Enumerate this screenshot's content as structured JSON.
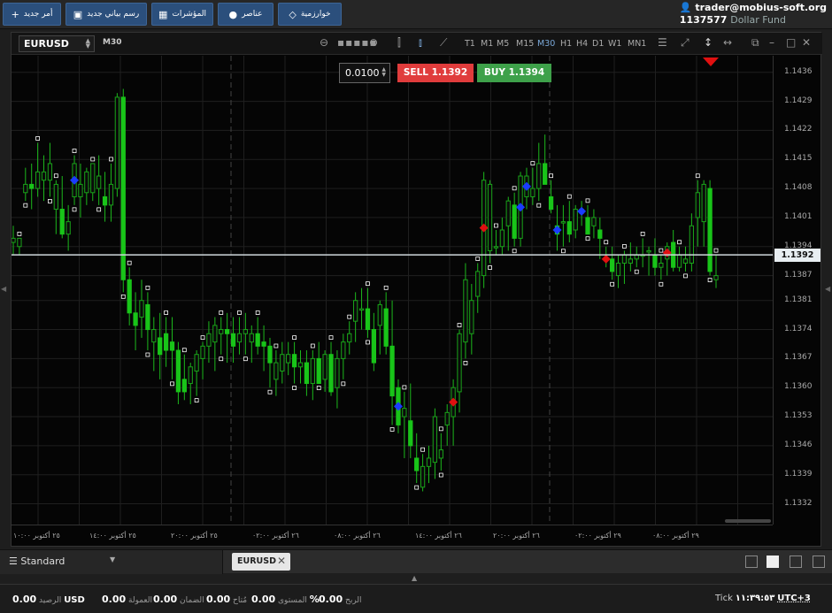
{
  "toolbar": {
    "new_order": "أمر جديد",
    "new_chart": "رسم بياني جديد",
    "indicators": "المؤشرات",
    "elements": "عناصر",
    "algorithms": "خوارزمية"
  },
  "account": {
    "email": "trader@mobius-soft.org",
    "id": "1137577",
    "fund": "Dollar Fund"
  },
  "chart": {
    "symbol": "EURUSD",
    "timeframe_badge": "M30",
    "timeframes": [
      "T1",
      "M1",
      "M5",
      "M15",
      "M30",
      "H1",
      "H4",
      "D1",
      "W1",
      "MN1"
    ],
    "active_timeframe": "M30",
    "lot": "0.0100",
    "sell_label": "SELL",
    "sell_price": "1.1392",
    "buy_label": "BUY",
    "buy_price": "1.1394",
    "current_price": "1.1392"
  },
  "chart_data": {
    "type": "candlestick",
    "price_ticks": [
      "1.1436",
      "1.1429",
      "1.1422",
      "1.1415",
      "1.1408",
      "1.1401",
      "1.1394",
      "1.1387",
      "1.1381",
      "1.1374",
      "1.1367",
      "1.1360",
      "1.1353",
      "1.1346",
      "1.1339",
      "1.1332"
    ],
    "ylim": [
      1.1327,
      1.144
    ],
    "time_ticks": [
      "٢٥ أكتوبر ١٠:٠٠",
      "٢٥ أكتوبر ١٤:٠٠",
      "٢٥ أكتوبر ٢٠:٠٠",
      "٢٦ أكتوبر ٠٢:٠٠",
      "٢٦ أكتوبر ٠٨:٠٠",
      "٢٦ أكتوبر ١٤:٠٠",
      "٢٦ أكتوبر ٢٠:٠٠",
      "٢٩ أكتوبر ٠٢:٠٠",
      "٢٩ أكتوبر ٠٨:٠٠"
    ],
    "candles": [
      [
        1.1395,
        1.1399,
        1.1392,
        1.1396
      ],
      [
        1.1394,
        1.1396,
        1.1392,
        1.1396
      ],
      [
        1.1407,
        1.1413,
        1.1405,
        1.1409
      ],
      [
        1.1409,
        1.1414,
        1.1403,
        1.1408
      ],
      [
        1.1408,
        1.1419,
        1.1406,
        1.1412
      ],
      [
        1.141,
        1.1416,
        1.1405,
        1.1412
      ],
      [
        1.141,
        1.1419,
        1.1406,
        1.1414
      ],
      [
        1.1403,
        1.141,
        1.1397,
        1.1409
      ],
      [
        1.1403,
        1.1411,
        1.1396,
        1.1397
      ],
      [
        1.1397,
        1.1404,
        1.1393,
        1.14
      ],
      [
        1.1406,
        1.1416,
        1.1404,
        1.1414
      ],
      [
        1.1406,
        1.1414,
        1.1401,
        1.1409
      ],
      [
        1.1407,
        1.1413,
        1.1404,
        1.1412
      ],
      [
        1.1407,
        1.1414,
        1.1405,
        1.1414
      ],
      [
        1.1408,
        1.1416,
        1.1404,
        1.1411
      ],
      [
        1.1406,
        1.1412,
        1.14,
        1.1404
      ],
      [
        1.1404,
        1.1414,
        1.14,
        1.1409
      ],
      [
        1.1408,
        1.1431,
        1.1406,
        1.143
      ],
      [
        1.143,
        1.1432,
        1.1383,
        1.1386
      ],
      [
        1.1386,
        1.1389,
        1.1375,
        1.1378
      ],
      [
        1.1378,
        1.1383,
        1.1369,
        1.1375
      ],
      [
        1.1377,
        1.1386,
        1.1372,
        1.1381
      ],
      [
        1.138,
        1.1383,
        1.1369,
        1.1374
      ],
      [
        1.1371,
        1.1377,
        1.1364,
        1.1374
      ],
      [
        1.1372,
        1.1378,
        1.1362,
        1.1368
      ],
      [
        1.1373,
        1.1377,
        1.1365,
        1.1369
      ],
      [
        1.1371,
        1.1377,
        1.1362,
        1.1369
      ],
      [
        1.1369,
        1.1371,
        1.1356,
        1.1359
      ],
      [
        1.1362,
        1.1368,
        1.1357,
        1.1359
      ],
      [
        1.1361,
        1.1366,
        1.1356,
        1.1365
      ],
      [
        1.1364,
        1.1369,
        1.1358,
        1.1368
      ],
      [
        1.1367,
        1.1371,
        1.1362,
        1.137
      ],
      [
        1.137,
        1.1376,
        1.1366,
        1.1373
      ],
      [
        1.1371,
        1.1377,
        1.1364,
        1.1375
      ],
      [
        1.1373,
        1.1377,
        1.1368,
        1.1374
      ],
      [
        1.1374,
        1.1378,
        1.1366,
        1.1373
      ],
      [
        1.1373,
        1.1377,
        1.1366,
        1.137
      ],
      [
        1.1371,
        1.1377,
        1.1368,
        1.1373
      ],
      [
        1.1373,
        1.1378,
        1.1368,
        1.1374
      ],
      [
        1.1371,
        1.1375,
        1.1366,
        1.1373
      ],
      [
        1.1373,
        1.1377,
        1.1368,
        1.137
      ],
      [
        1.1371,
        1.1375,
        1.1364,
        1.137
      ],
      [
        1.137,
        1.1372,
        1.136,
        1.1366
      ],
      [
        1.1362,
        1.1369,
        1.1358,
        1.1366
      ],
      [
        1.1364,
        1.1371,
        1.1361,
        1.1368
      ],
      [
        1.1366,
        1.1371,
        1.1363,
        1.1368
      ],
      [
        1.1368,
        1.1371,
        1.1361,
        1.1365
      ],
      [
        1.1365,
        1.1369,
        1.1361,
        1.1366
      ],
      [
        1.1366,
        1.1369,
        1.1358,
        1.1361
      ],
      [
        1.1361,
        1.1369,
        1.1357,
        1.1367
      ],
      [
        1.1367,
        1.1371,
        1.1361,
        1.1361
      ],
      [
        1.1362,
        1.1369,
        1.1359,
        1.1368
      ],
      [
        1.1368,
        1.1371,
        1.1358,
        1.1359
      ],
      [
        1.136,
        1.1369,
        1.1355,
        1.1367
      ],
      [
        1.1367,
        1.1373,
        1.1362,
        1.1371
      ],
      [
        1.1371,
        1.1376,
        1.1368,
        1.1373
      ],
      [
        1.1376,
        1.1383,
        1.1371,
        1.1381
      ],
      [
        1.1379,
        1.1384,
        1.1374,
        1.1379
      ],
      [
        1.1379,
        1.1384,
        1.1372,
        1.1374
      ],
      [
        1.1374,
        1.1378,
        1.1364,
        1.1366
      ],
      [
        1.1375,
        1.1381,
        1.1368,
        1.138
      ],
      [
        1.1379,
        1.1383,
        1.1368,
        1.137
      ],
      [
        1.137,
        1.1381,
        1.1351,
        1.1358
      ],
      [
        1.136,
        1.1362,
        1.1349,
        1.1351
      ],
      [
        1.1353,
        1.1359,
        1.1343,
        1.1355
      ],
      [
        1.1352,
        1.1361,
        1.1343,
        1.1346
      ],
      [
        1.1343,
        1.1349,
        1.1337,
        1.134
      ],
      [
        1.1336,
        1.1344,
        1.1335,
        1.1341
      ],
      [
        1.1341,
        1.1346,
        1.1337,
        1.1343
      ],
      [
        1.1342,
        1.1355,
        1.1338,
        1.1353
      ],
      [
        1.1343,
        1.1349,
        1.134,
        1.1345
      ],
      [
        1.1351,
        1.1356,
        1.1346,
        1.1354
      ],
      [
        1.1353,
        1.1362,
        1.1346,
        1.136
      ],
      [
        1.1359,
        1.1374,
        1.1354,
        1.1373
      ],
      [
        1.1371,
        1.139,
        1.1367,
        1.1386
      ],
      [
        1.1373,
        1.1385,
        1.1368,
        1.1381
      ],
      [
        1.1382,
        1.139,
        1.1378,
        1.1388
      ],
      [
        1.1387,
        1.1412,
        1.1384,
        1.141
      ],
      [
        1.1393,
        1.141,
        1.139,
        1.1409
      ],
      [
        1.1394,
        1.1398,
        1.1392,
        1.1394
      ],
      [
        1.1394,
        1.1401,
        1.1392,
        1.1398
      ],
      [
        1.1399,
        1.1406,
        1.1393,
        1.1405
      ],
      [
        1.1404,
        1.1407,
        1.1394,
        1.1396
      ],
      [
        1.1396,
        1.1412,
        1.1394,
        1.1411
      ],
      [
        1.1406,
        1.1413,
        1.1403,
        1.1411
      ],
      [
        1.1406,
        1.1413,
        1.1404,
        1.1408
      ],
      [
        1.1408,
        1.1419,
        1.1405,
        1.1414
      ],
      [
        1.1414,
        1.1421,
        1.1409,
        1.1409
      ],
      [
        1.1406,
        1.141,
        1.1402,
        1.1403
      ],
      [
        1.1399,
        1.1404,
        1.1393,
        1.1397
      ],
      [
        1.14,
        1.1404,
        1.1394,
        1.14
      ],
      [
        1.14,
        1.1405,
        1.1395,
        1.1397
      ],
      [
        1.1398,
        1.1404,
        1.1396,
        1.1403
      ],
      [
        1.1402,
        1.1405,
        1.1399,
        1.1403
      ],
      [
        1.1401,
        1.1404,
        1.1397,
        1.1397
      ],
      [
        1.1399,
        1.1403,
        1.1396,
        1.1401
      ],
      [
        1.1398,
        1.1401,
        1.1391,
        1.1396
      ],
      [
        1.1391,
        1.1394,
        1.1389,
        1.1391
      ],
      [
        1.1391,
        1.1394,
        1.1386,
        1.1388
      ],
      [
        1.1387,
        1.1392,
        1.1384,
        1.139
      ],
      [
        1.139,
        1.1393,
        1.1385,
        1.1392
      ],
      [
        1.139,
        1.1395,
        1.1388,
        1.1391
      ],
      [
        1.1391,
        1.1394,
        1.1389,
        1.1392
      ],
      [
        1.1392,
        1.1396,
        1.1389,
        1.1392
      ],
      [
        1.1393,
        1.1394,
        1.1387,
        1.1393
      ],
      [
        1.1392,
        1.1396,
        1.1387,
        1.1389
      ],
      [
        1.1389,
        1.1392,
        1.1386,
        1.139
      ],
      [
        1.1391,
        1.1395,
        1.1387,
        1.1394
      ],
      [
        1.1395,
        1.1398,
        1.1388,
        1.1389
      ],
      [
        1.1389,
        1.1394,
        1.1388,
        1.1392
      ],
      [
        1.139,
        1.1394,
        1.1388,
        1.1391
      ],
      [
        1.139,
        1.1402,
        1.1388,
        1.1399
      ],
      [
        1.1401,
        1.141,
        1.1394,
        1.1407
      ],
      [
        1.14,
        1.141,
        1.1394,
        1.1409
      ],
      [
        1.1408,
        1.141,
        1.1387,
        1.1388
      ],
      [
        1.1386,
        1.1392,
        1.1384,
        1.1387
      ]
    ],
    "markers": {
      "blue": [
        10,
        63,
        83,
        84,
        89,
        93,
        107
      ],
      "red": [
        72,
        77,
        97,
        107
      ]
    }
  },
  "tabs": {
    "template": "Standard",
    "active_tab": "EURUSD"
  },
  "status": {
    "balance_label": "الرصيد",
    "balance": "0.00",
    "currency": "USD",
    "commission_label": "العمولة",
    "commission": "0.00",
    "margin_label": "الضمان",
    "margin": "0.00",
    "free_label": "مُتاح",
    "free": "0.00",
    "level_label": "المستوى",
    "level": "0.00",
    "level_unit": "%",
    "profit_label": "الربح",
    "profit": "0.00",
    "tick_label": "Tick",
    "time": "١١:٣٩:٥٣",
    "timezone": "UTC+3"
  }
}
